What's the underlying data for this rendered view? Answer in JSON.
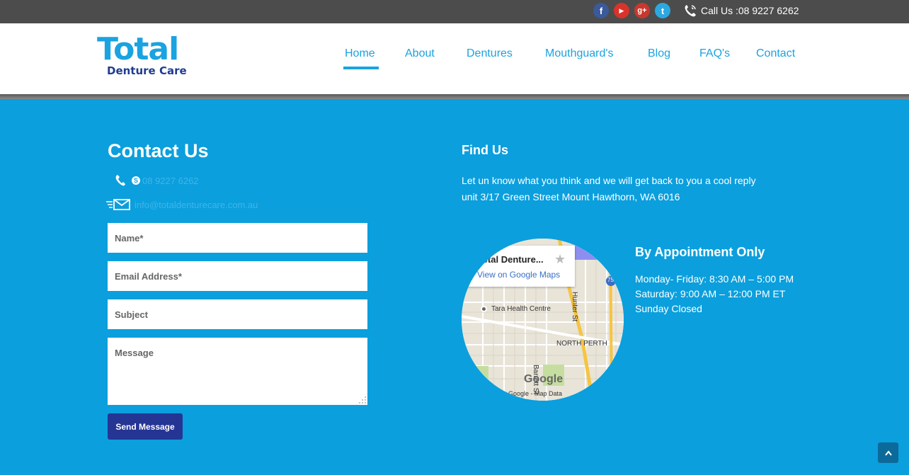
{
  "topbar": {
    "social": [
      {
        "name": "facebook",
        "glyph": "f"
      },
      {
        "name": "youtube",
        "glyph": "▶"
      },
      {
        "name": "google-plus",
        "glyph": "g+"
      },
      {
        "name": "twitter",
        "glyph": "t"
      }
    ],
    "call_text": "Call Us :08 9227 6262",
    "call_icon": "phone-icon"
  },
  "logo": {
    "top": "Total",
    "bottom": "Denture Care"
  },
  "nav": {
    "items": [
      "Home",
      "About",
      "Dentures",
      "Mouthguard's",
      "Blog",
      "FAQ's",
      "Contact"
    ],
    "active": "Home",
    "color": "#1aa3e0"
  },
  "contact": {
    "title": "Contact Us",
    "phone": "08 9227 6262",
    "email": "info@totaldenturecare.com.au",
    "form": {
      "name_placeholder": "Name*",
      "email_placeholder": "Email Address*",
      "subject_placeholder": "Subject",
      "message_placeholder": "Message",
      "send_label": "Send Message"
    }
  },
  "find": {
    "title": "Find Us",
    "line1": "Let un know what you think and we will get back to you a cool reply",
    "line2": "unit 3/17 Green Street Mount Hawthorn, WA 6016"
  },
  "map": {
    "card_title": "Total Denture...",
    "card_link": "View on Google Maps",
    "labels": {
      "health": "Tara Health Centre",
      "hunter": "Hunter St",
      "north_perth": "NORTH PERTH",
      "barrett": "Barrett St",
      "route": "75",
      "google": "Google",
      "footer": "Google - Map Data"
    }
  },
  "appointment": {
    "title": "By Appointment Only",
    "hours": [
      "Monday- Friday: 8:30 AM – 5:00 PM",
      "Saturday: 9:00 AM – 12:00 PM ET",
      "Sunday Closed"
    ]
  },
  "colors": {
    "background": "#0b9fdd",
    "accent": "#1aa3e0",
    "button": "#253594"
  }
}
